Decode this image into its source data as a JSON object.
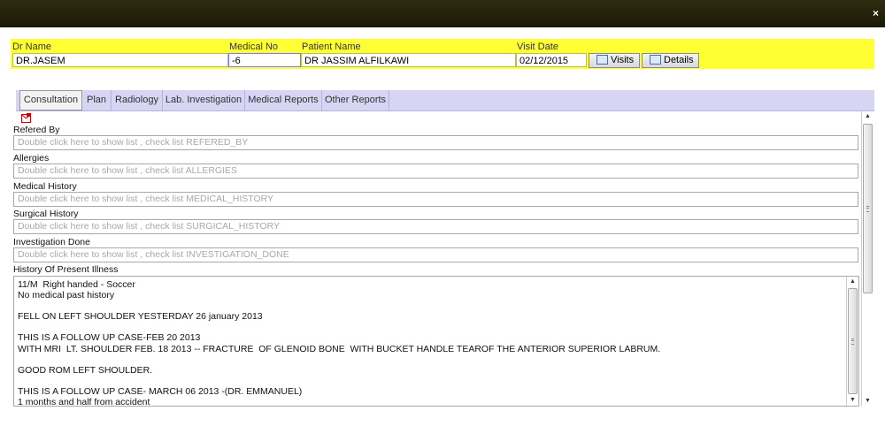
{
  "window": {
    "close_label": "×"
  },
  "patient_bar": {
    "dr_name_label": "Dr Name",
    "dr_name_value": "DR.JASEM",
    "medical_no_label": "Medical No",
    "medical_no_value": "-6",
    "patient_name_label": "Patient Name",
    "patient_name_value": "DR JASSIM ALFILKAWI",
    "visit_date_label": "Visit Date",
    "visit_date_value": "02/12/2015",
    "visits_button": "Visits",
    "details_button": "Details"
  },
  "tabs": [
    {
      "label": "Consultation",
      "active": true
    },
    {
      "label": "Plan"
    },
    {
      "label": "Radiology"
    },
    {
      "label": "Lab. Investigation"
    },
    {
      "label": "Medical Reports"
    },
    {
      "label": "Other Reports"
    }
  ],
  "sections": {
    "refered_by": {
      "label": "Refered By",
      "placeholder": "Double click here to show list , check list REFERED_BY"
    },
    "allergies": {
      "label": "Allergies",
      "placeholder": "Double click here to show list , check list ALLERGIES"
    },
    "medical_history": {
      "label": "Medical History",
      "placeholder": "Double click here to show list , check list MEDICAL_HISTORY"
    },
    "surgical_history": {
      "label": "Surgical History",
      "placeholder": "Double click here to show list , check list SURGICAL_HISTORY"
    },
    "investigation_done": {
      "label": "Investigation Done",
      "placeholder": "Double click here to show list , check list INVESTIGATION_DONE"
    },
    "history_present_illness": {
      "label": "History Of Present Illness",
      "text": "11/M  Right handed - Soccer\nNo medical past history\n\nFELL ON LEFT SHOULDER YESTERDAY 26 january 2013\n\nTHIS IS A FOLLOW UP CASE-FEB 20 2013\nWITH MRI  LT. SHOULDER FEB. 18 2013 -- FRACTURE  OF GLENOID BONE  WITH BUCKET HANDLE TEAROF THE ANTERIOR SUPERIOR LABRUM.\n\nGOOD ROM LEFT SHOULDER.\n\nTHIS IS A FOLLOW UP CASE- MARCH 06 2013 -(DR. EMMANUEL)\n1 months and half from accident"
    }
  },
  "icons": {
    "close": "close-icon",
    "visits": "calendar-grid-icon",
    "details": "details-grid-icon",
    "print": "pdf-print-icon"
  },
  "colors": {
    "titlebar": "#1c1a06",
    "patient_bar": "#ffff33",
    "tab_strip": "#d6d6f4"
  }
}
